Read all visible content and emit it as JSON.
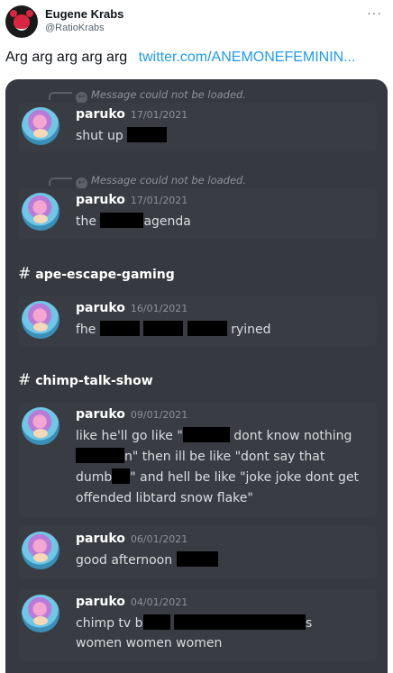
{
  "tweet": {
    "display_name": "Eugene Krabs",
    "handle": "@RatioKrabs",
    "more_glyph": "···",
    "text": "Arg arg arg arg arg",
    "link": "twitter.com/ANEMONEFEMININ..."
  },
  "discord": {
    "reply_notice": "Message could not be loaded.",
    "channels": [
      "ape-escape-gaming",
      "chimp-talk-show"
    ],
    "messages": [
      {
        "user": "paruko",
        "date": "17/01/2021",
        "parts": [
          "shut up "
        ]
      },
      {
        "user": "paruko",
        "date": "17/01/2021",
        "parts": [
          "the ",
          "agenda"
        ]
      },
      {
        "user": "paruko",
        "date": "16/01/2021",
        "parts": [
          "fhe ",
          "ryined"
        ]
      },
      {
        "user": "paruko",
        "date": "09/01/2021",
        "parts": [
          "like he'll go like \"",
          "dont know nothing",
          "n\" then ill be like \"dont say that dumb",
          "\" and hell be like \"joke joke dont get offended libtard snow flake\""
        ]
      },
      {
        "user": "paruko",
        "date": "06/01/2021",
        "parts": [
          "good afternoon "
        ]
      },
      {
        "user": "paruko",
        "date": "04/01/2021",
        "parts": [
          "chimp tv b",
          "s",
          "women women women"
        ]
      }
    ]
  },
  "colors": {
    "discord_bg": "#36393f",
    "message_bg": "#393c43",
    "link": "#1d9bf0",
    "muted": "#8e9297"
  },
  "icons": {
    "avatar": "crab-avatar-icon",
    "reply": "reply-arrow-icon",
    "channel": "hash-icon"
  }
}
